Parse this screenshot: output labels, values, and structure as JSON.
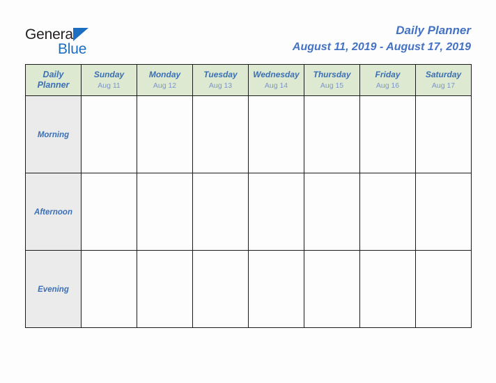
{
  "brand": {
    "name_part1": "General",
    "name_part2": "Blue",
    "triangle_icon": "triangle-icon",
    "colors": {
      "dark": "#231f20",
      "blue": "#1b6ec2"
    }
  },
  "header": {
    "title": "Daily Planner",
    "date_range": "August 11, 2019 - August 17, 2019",
    "accent_color": "#4472c4"
  },
  "table": {
    "corner_label_line1": "Daily",
    "corner_label_line2": "Planner",
    "header_background": "#dde9d0",
    "row_label_background": "#ebebeb",
    "cell_background": "#fdfdfd",
    "border_color": "#1a1a1a",
    "day_name_color": "#3b6fb6",
    "day_date_color": "#7b95c9",
    "columns": [
      {
        "day": "Sunday",
        "date": "Aug 11"
      },
      {
        "day": "Monday",
        "date": "Aug 12"
      },
      {
        "day": "Tuesday",
        "date": "Aug 13"
      },
      {
        "day": "Wednesday",
        "date": "Aug 14"
      },
      {
        "day": "Thursday",
        "date": "Aug 15"
      },
      {
        "day": "Friday",
        "date": "Aug 16"
      },
      {
        "day": "Saturday",
        "date": "Aug 17"
      }
    ],
    "rows": [
      {
        "label": "Morning",
        "entries": [
          "",
          "",
          "",
          "",
          "",
          "",
          ""
        ]
      },
      {
        "label": "Afternoon",
        "entries": [
          "",
          "",
          "",
          "",
          "",
          "",
          ""
        ]
      },
      {
        "label": "Evening",
        "entries": [
          "",
          "",
          "",
          "",
          "",
          "",
          ""
        ]
      }
    ]
  }
}
